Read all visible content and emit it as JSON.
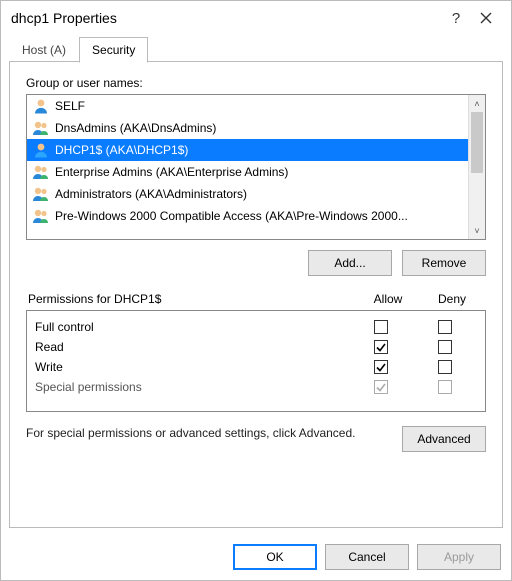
{
  "title": "dhcp1 Properties",
  "tabs": [
    {
      "label": "Host (A)",
      "active": false
    },
    {
      "label": "Security",
      "active": true
    }
  ],
  "group_label": "Group or user names:",
  "principals": [
    {
      "name": "SELF",
      "type": "user",
      "selected": false
    },
    {
      "name": "DnsAdmins (AKA\\DnsAdmins)",
      "type": "group",
      "selected": false
    },
    {
      "name": "DHCP1$ (AKA\\DHCP1$)",
      "type": "user",
      "selected": true
    },
    {
      "name": "Enterprise Admins (AKA\\Enterprise Admins)",
      "type": "group",
      "selected": false
    },
    {
      "name": "Administrators (AKA\\Administrators)",
      "type": "group",
      "selected": false
    },
    {
      "name": "Pre-Windows 2000 Compatible Access (AKA\\Pre-Windows 2000...",
      "type": "group",
      "selected": false
    }
  ],
  "buttons": {
    "add": "Add...",
    "remove": "Remove",
    "advanced": "Advanced",
    "ok": "OK",
    "cancel": "Cancel",
    "apply": "Apply"
  },
  "perm_header": {
    "label": "Permissions for DHCP1$",
    "allow": "Allow",
    "deny": "Deny"
  },
  "permissions": [
    {
      "name": "Full control",
      "allow": false,
      "deny": false,
      "disabled": false
    },
    {
      "name": "Read",
      "allow": true,
      "deny": false,
      "disabled": false
    },
    {
      "name": "Write",
      "allow": true,
      "deny": false,
      "disabled": false
    },
    {
      "name": "Special permissions",
      "allow": true,
      "deny": false,
      "disabled": true
    }
  ],
  "note": "For special permissions or advanced settings, click Advanced."
}
